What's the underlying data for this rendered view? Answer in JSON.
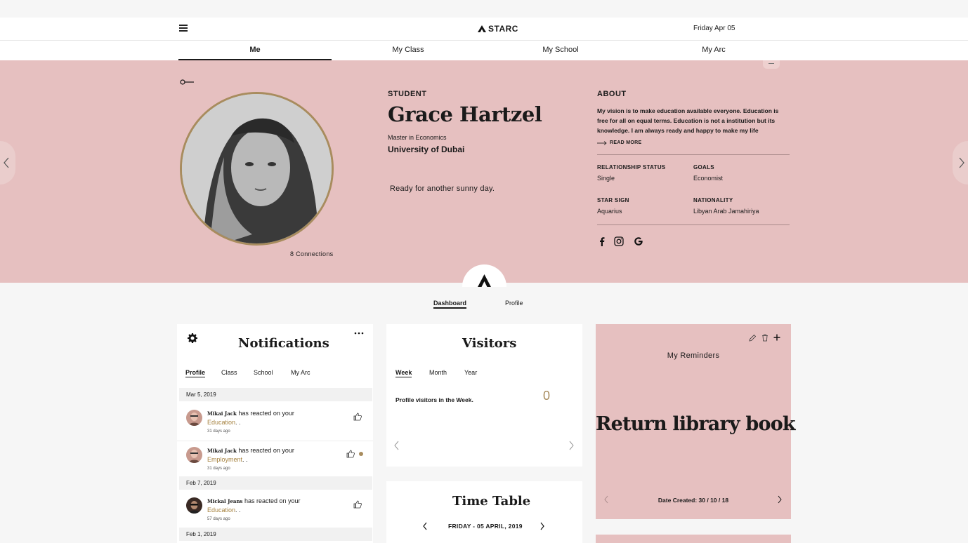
{
  "header": {
    "brand": "STARC",
    "date": "Friday Apr 05"
  },
  "nav": {
    "tabs": [
      {
        "label": "Me",
        "active": true
      },
      {
        "label": "My Class",
        "active": false
      },
      {
        "label": "My School",
        "active": false
      },
      {
        "label": "My Arc",
        "active": false
      }
    ]
  },
  "profile": {
    "role": "STUDENT",
    "name": "Grace Hartzel",
    "degree": "Master in Economics",
    "university": "University of Dubai",
    "status": "Ready for another sunny day.",
    "connections": "8 Connections",
    "about_title": "ABOUT",
    "about_text": "My vision is to make education available everyone. Education is free for all on equal terms. Education is not a institution but its knowledge. I am always ready and happy to make my life",
    "read_more": "READ MORE",
    "facts": [
      {
        "label": "RELATIONSHIP STATUS",
        "value": "Single"
      },
      {
        "label": "GOALS",
        "value": "Economist"
      },
      {
        "label": "STAR SIGN",
        "value": "Aquarius"
      },
      {
        "label": "NATIONALITY",
        "value": "Libyan Arab Jamahiriya"
      }
    ],
    "social": [
      "facebook-icon",
      "instagram-icon",
      "google-icon"
    ]
  },
  "dashboard_tabs": [
    {
      "label": "Dashboard",
      "active": true
    },
    {
      "label": "Profile",
      "active": false
    }
  ],
  "notifications": {
    "title": "Notifications",
    "tabs": [
      {
        "label": "Profile",
        "active": true
      },
      {
        "label": "Class",
        "active": false
      },
      {
        "label": "School",
        "active": false
      },
      {
        "label": "My Arc",
        "active": false
      }
    ],
    "groups": [
      {
        "date": "Mar 5, 2019"
      },
      {
        "date": "Feb 7, 2019"
      },
      {
        "date": "Feb 1, 2019"
      }
    ],
    "items": [
      {
        "name": "Mikai Jack",
        "action": "has reacted on your",
        "link": "Education",
        "suffix": ". .",
        "time": "31 days ago",
        "unread": false
      },
      {
        "name": "Mikai Jack",
        "action": "has reacted on your",
        "link": "Employment",
        "suffix": ". .",
        "time": "31 days ago",
        "unread": true
      },
      {
        "name": "Mickal Jeans",
        "action": "has reacted on your",
        "link": "Education",
        "suffix": ". .",
        "time": "57 days ago",
        "unread": false
      }
    ]
  },
  "visitors": {
    "title": "Visitors",
    "tabs": [
      {
        "label": "Week",
        "active": true
      },
      {
        "label": "Month",
        "active": false
      },
      {
        "label": "Year",
        "active": false
      }
    ],
    "label": "Profile visitors in the Week.",
    "count": "0"
  },
  "timetable": {
    "title": "Time Table",
    "date": "FRIDAY - 05 APRIL, 2019"
  },
  "reminders": {
    "title": "My Reminders",
    "text": "Return library book",
    "created": "Date Created: 30 / 10 / 18"
  },
  "colors": {
    "accent_pink": "#e6c0c0",
    "gold": "#a88c5e"
  }
}
